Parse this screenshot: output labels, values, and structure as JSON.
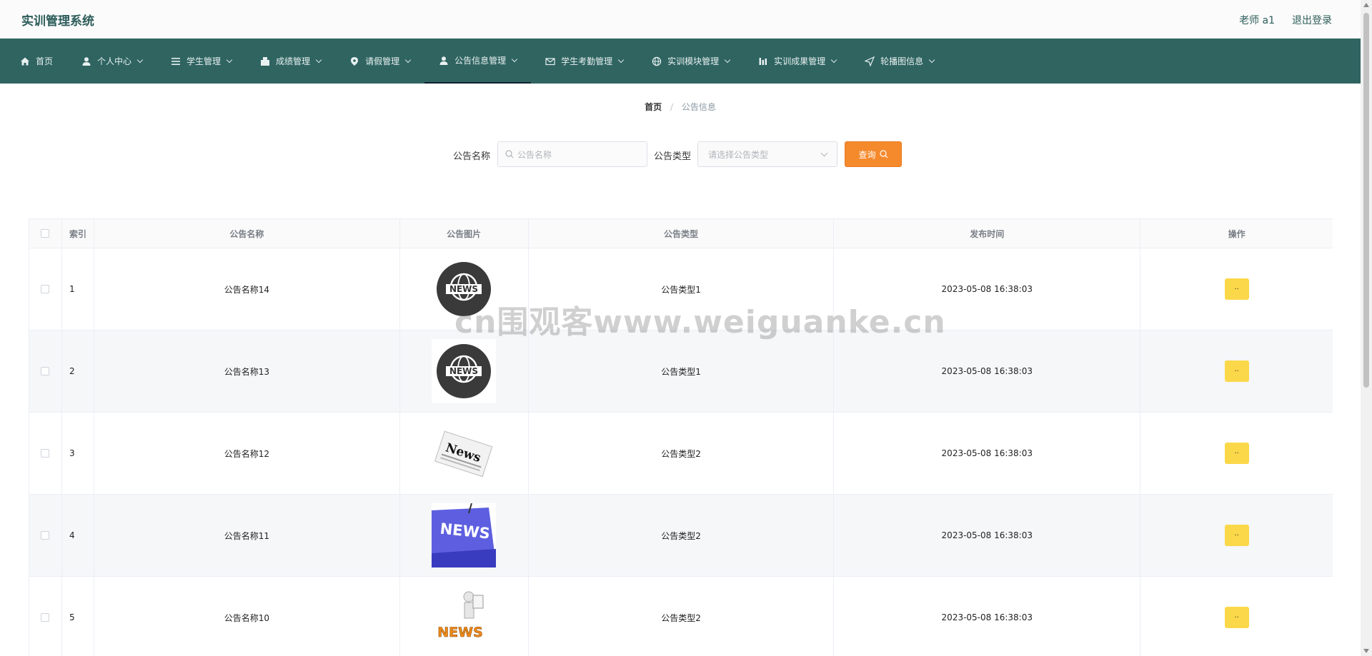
{
  "app": {
    "title": "实训管理系统"
  },
  "header": {
    "user": "老师 a1",
    "logout": "退出登录"
  },
  "nav": {
    "items": [
      {
        "label": "首页",
        "icon": "home-icon",
        "dropdown": false
      },
      {
        "label": "个人中心",
        "icon": "user-icon",
        "dropdown": true
      },
      {
        "label": "学生管理",
        "icon": "menu-icon",
        "dropdown": true
      },
      {
        "label": "成绩管理",
        "icon": "gift-icon",
        "dropdown": true
      },
      {
        "label": "请假管理",
        "icon": "location-icon",
        "dropdown": true
      },
      {
        "label": "公告信息管理",
        "icon": "user-icon",
        "dropdown": true,
        "active": true
      },
      {
        "label": "学生考勤管理",
        "icon": "mail-icon",
        "dropdown": true
      },
      {
        "label": "实训模块管理",
        "icon": "globe-icon",
        "dropdown": true
      },
      {
        "label": "实训成果管理",
        "icon": "chart-icon",
        "dropdown": true
      },
      {
        "label": "轮播图信息",
        "icon": "send-icon",
        "dropdown": true
      }
    ]
  },
  "breadcrumb": {
    "home": "首页",
    "separator": "/",
    "current": "公告信息"
  },
  "search": {
    "name_label": "公告名称",
    "name_placeholder": "公告名称",
    "type_label": "公告类型",
    "type_placeholder": "请选择公告类型",
    "query_label": "查询"
  },
  "table": {
    "headers": {
      "index": "索引",
      "name": "公告名称",
      "image": "公告图片",
      "type": "公告类型",
      "time": "发布时间",
      "op": "操作"
    },
    "rows": [
      {
        "index": "1",
        "name": "公告名称14",
        "image": "news-globe-dark",
        "type": "公告类型1",
        "time": "2023-05-08 16:38:03",
        "op": "··"
      },
      {
        "index": "2",
        "name": "公告名称13",
        "image": "news-globe-dark",
        "type": "公告类型1",
        "time": "2023-05-08 16:38:03",
        "op": "··"
      },
      {
        "index": "3",
        "name": "公告名称12",
        "image": "news-paper",
        "type": "公告类型2",
        "time": "2023-05-08 16:38:03",
        "op": "··"
      },
      {
        "index": "4",
        "name": "公告名称11",
        "image": "news-key-blue",
        "type": "公告类型2",
        "time": "2023-05-08 16:38:03",
        "op": "··"
      },
      {
        "index": "5",
        "name": "公告名称10",
        "image": "news-figure-orange",
        "type": "公告类型2",
        "time": "2023-05-08 16:38:03",
        "op": "··"
      }
    ]
  },
  "watermark": "cn围观客www.weiguanke.cn",
  "colors": {
    "nav_bg": "#2f6461",
    "brand": "#2d5d5a",
    "query_btn": "#f58a2d",
    "op_btn": "#fbd84a"
  }
}
